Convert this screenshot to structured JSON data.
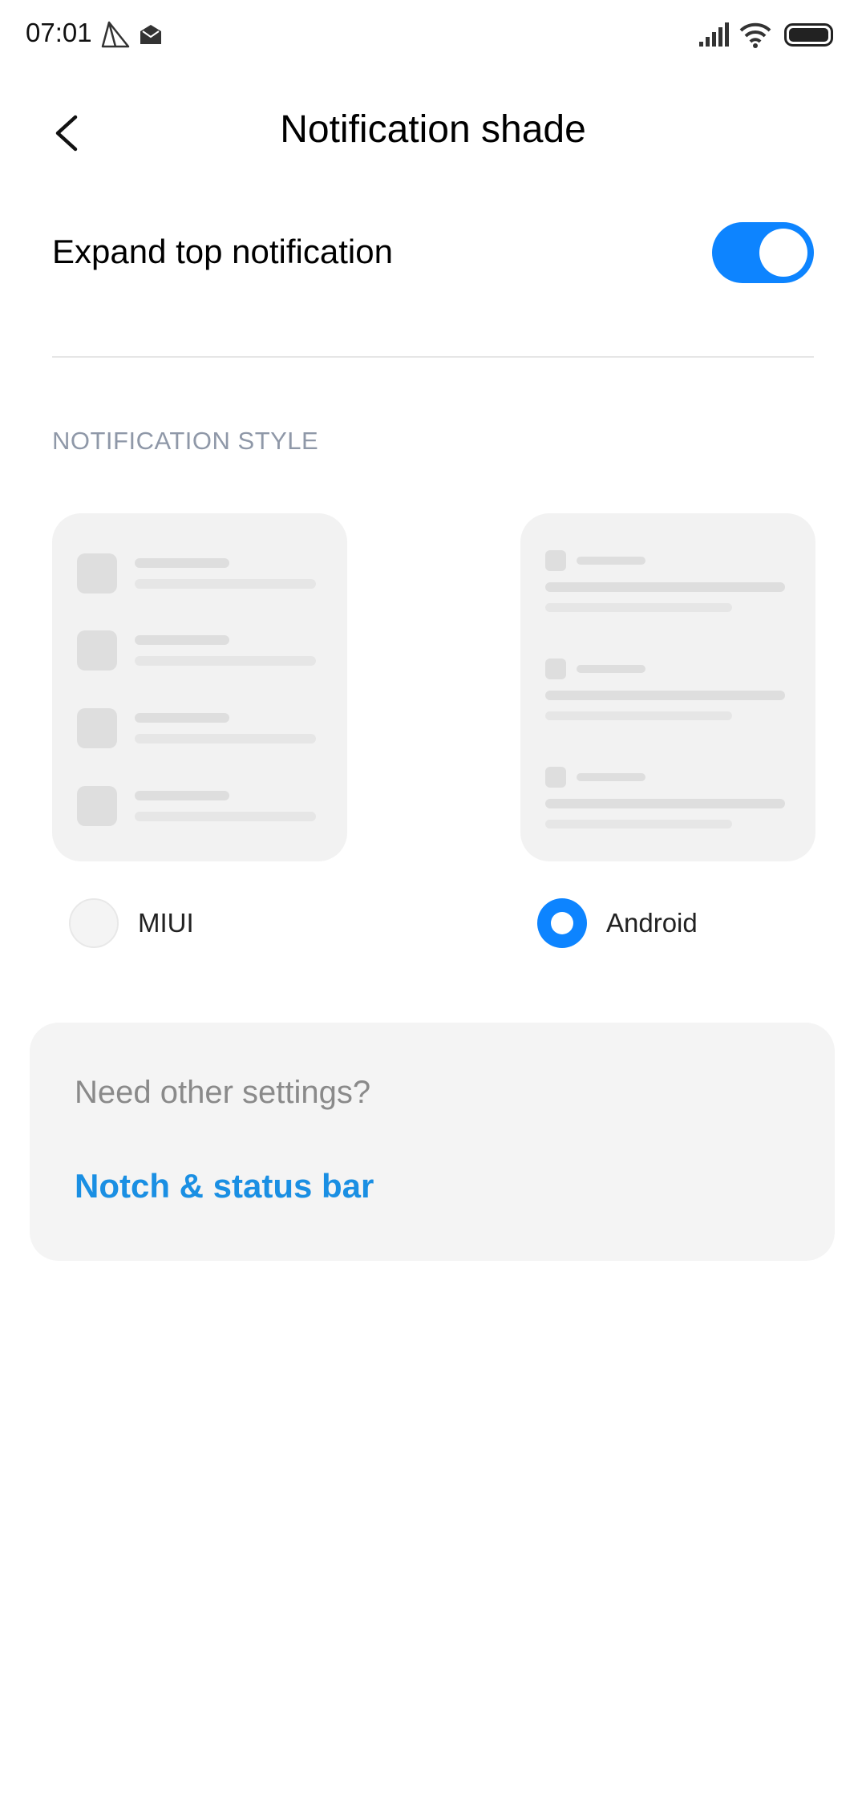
{
  "status_bar": {
    "time": "07:01",
    "left_icons": [
      "paper-plane-icon",
      "mail-icon"
    ],
    "right_icons": [
      "signal-icon",
      "wifi-icon",
      "battery-icon"
    ]
  },
  "header": {
    "title": "Notification shade",
    "back_icon": "back-arrow-icon"
  },
  "toggle": {
    "label": "Expand top notification",
    "state": "on",
    "accent_color": "#0d84ff"
  },
  "notification_style": {
    "section_title": "NOTIFICATION STYLE",
    "options": [
      {
        "label": "MIUI",
        "selected": false
      },
      {
        "label": "Android",
        "selected": true
      }
    ]
  },
  "other_settings": {
    "question": "Need other settings?",
    "link_label": "Notch & status bar",
    "link_color": "#1a8fe3"
  }
}
